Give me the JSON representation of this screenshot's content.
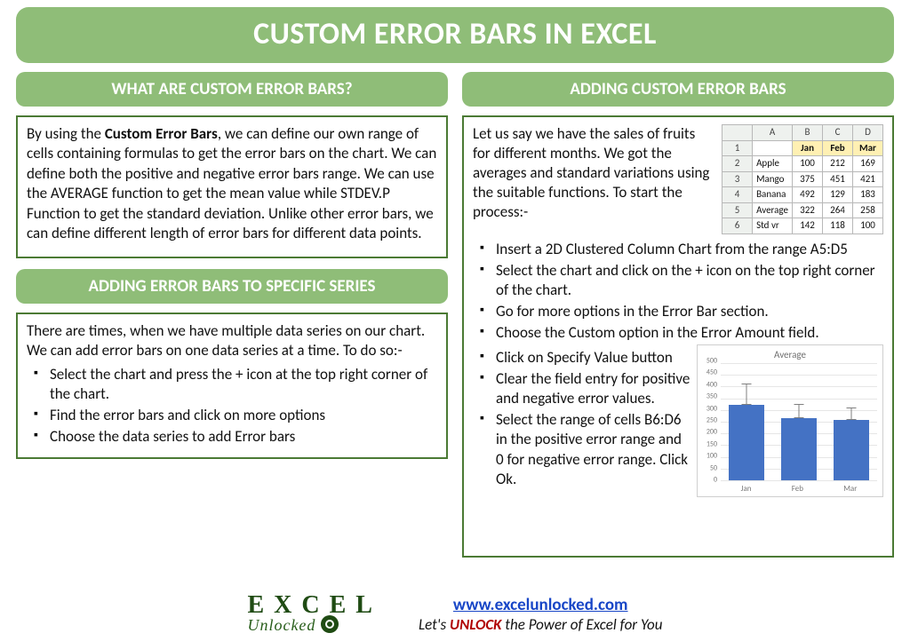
{
  "title": "CUSTOM ERROR BARS IN EXCEL",
  "left": {
    "section1_header": "WHAT ARE CUSTOM ERROR BARS?",
    "section1_text_before": "By using the ",
    "section1_bold": "Custom Error Bars",
    "section1_text_after": ", we can define our own range of cells containing formulas to get the error bars on the chart. We can define both the positive and negative error bars range. We can use the AVERAGE function to get the mean value while STDEV.P Function to get the standard deviation. Unlike other error bars, we can define different length of error bars for different data points.",
    "section2_header": "ADDING ERROR BARS TO SPECIFIC SERIES",
    "section2_intro": "There are times, when we have multiple data series on our chart. We can add error bars on one data series at a time. To do so:-",
    "section2_bullets": [
      "Select the chart and press the + icon at the top right corner of the chart.",
      "Find the error bars and click on more options",
      "Choose the data series to add Error bars"
    ]
  },
  "right": {
    "header": "ADDING CUSTOM ERROR BARS",
    "intro": "Let us say we have the sales of fruits for different months. We got the averages and standard variations using the suitable functions. To start the process:-",
    "table": {
      "col_heads": [
        "",
        "A",
        "B",
        "C",
        "D"
      ],
      "rows": [
        [
          "1",
          "",
          "Jan",
          "Feb",
          "Mar"
        ],
        [
          "2",
          "Apple",
          "100",
          "212",
          "169"
        ],
        [
          "3",
          "Mango",
          "375",
          "451",
          "421"
        ],
        [
          "4",
          "Banana",
          "492",
          "129",
          "183"
        ],
        [
          "5",
          "Average",
          "322",
          "264",
          "258"
        ],
        [
          "6",
          "Std vr",
          "142",
          "118",
          "100"
        ]
      ]
    },
    "steps_upper": [
      "Insert a 2D Clustered Column Chart from the range A5:D5",
      "Select the chart and click on the + icon on the top right corner of the chart.",
      "Go for more options in the Error Bar section.",
      "Choose the Custom option in the Error Amount field."
    ],
    "steps_lower": [
      "Click on Specify Value button",
      "Clear the field entry for positive and negative error values.",
      "Select the range of cells B6:D6 in the positive error range and 0 for negative error range. Click Ok."
    ]
  },
  "chart_data": {
    "type": "bar",
    "title": "Average",
    "categories": [
      "Jan",
      "Feb",
      "Mar"
    ],
    "values": [
      322,
      264,
      258
    ],
    "error_pos": [
      142,
      118,
      100
    ],
    "error_neg": [
      0,
      0,
      0
    ],
    "ylim": [
      0,
      500
    ],
    "yticks": [
      0,
      50,
      100,
      150,
      200,
      250,
      300,
      350,
      400,
      450,
      500
    ],
    "xlabel": "",
    "ylabel": ""
  },
  "footer": {
    "logo_row1": "E X C E L",
    "logo_row2": "Unlocked",
    "url": "www.excelunlocked.com",
    "tagline_before": "Let's ",
    "tagline_bold": "UNLOCK",
    "tagline_after": " the Power of Excel for You"
  }
}
